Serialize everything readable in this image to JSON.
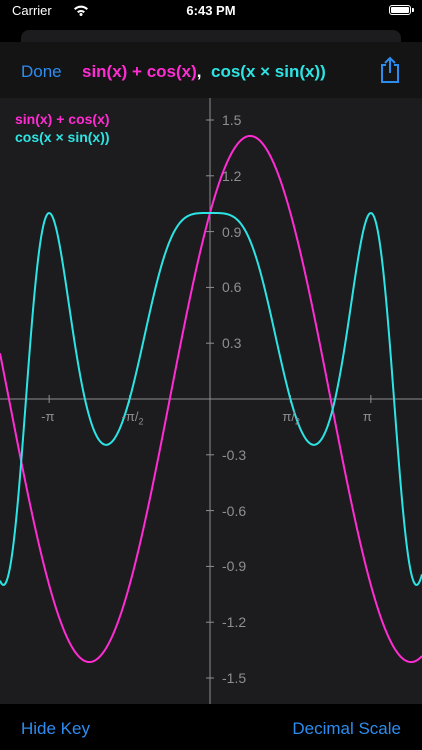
{
  "status": {
    "carrier": "Carrier",
    "time": "6:43 PM"
  },
  "header": {
    "done": "Done",
    "formula1": "sin(x) + cos(x)",
    "separator": ",",
    "formula2": "cos(x × sin(x))",
    "share_icon": "share-icon"
  },
  "legend": {
    "f1": "sin(x) + cos(x)",
    "f2": "cos(x × sin(x))"
  },
  "colors": {
    "f1": "#ff2cd3",
    "f2": "#2de4e4",
    "accent": "#2d8cf0",
    "axis": "#8e8e93",
    "background": "#1c1c1e"
  },
  "chart_data": {
    "type": "line",
    "x_range": [
      -4.14,
      4.14
    ],
    "ylim": [
      -1.72,
      1.57
    ],
    "y_ticks": [
      "1.5",
      "1.2",
      "0.9",
      "0.6",
      "0.3",
      "-0.3",
      "-0.6",
      "-0.9",
      "-1.2",
      "-1.5"
    ],
    "x_ticks": [
      {
        "value": -3.14159,
        "label": "-π"
      },
      {
        "value": -1.5708,
        "label": "-π/2"
      },
      {
        "value": 1.5708,
        "label": "π/2"
      },
      {
        "value": 3.14159,
        "label": "π"
      }
    ],
    "series": [
      {
        "name": "sin(x) + cos(x)",
        "function": "sin(x)+cos(x)"
      },
      {
        "name": "cos(x × sin(x))",
        "function": "cos(x*sin(x))"
      }
    ]
  },
  "bottom": {
    "hide_key": "Hide Key",
    "scale": "Decimal Scale"
  }
}
